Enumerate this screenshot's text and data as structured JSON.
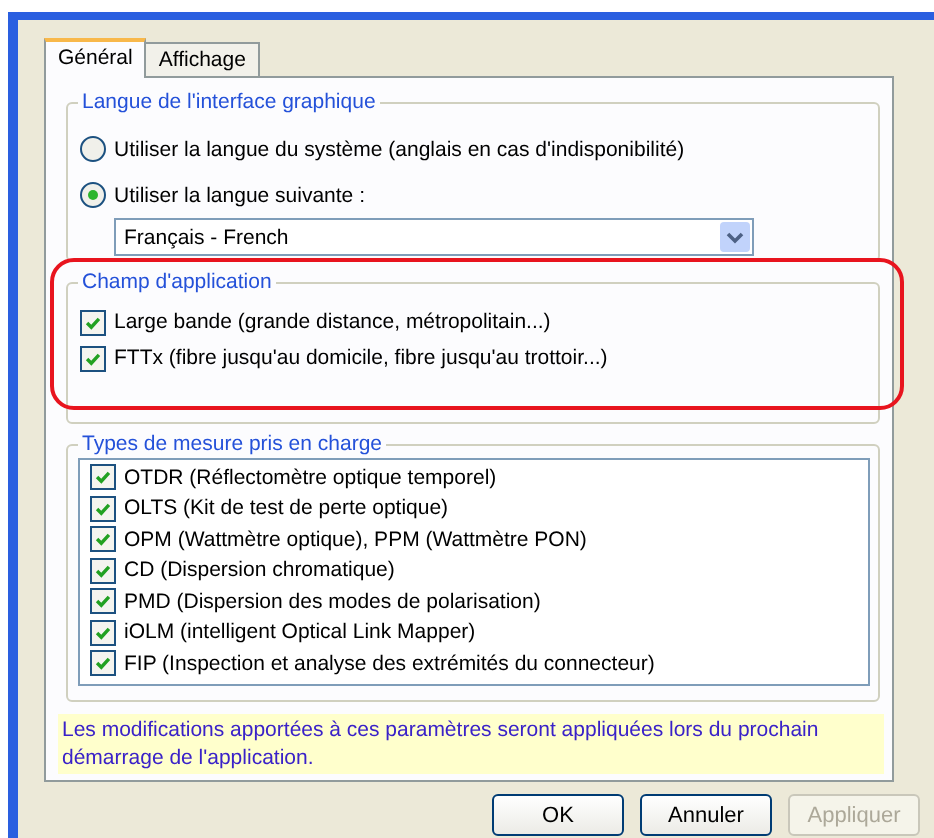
{
  "tabs": [
    {
      "label": "Général",
      "selected": true
    },
    {
      "label": "Affichage",
      "selected": false
    }
  ],
  "language_group": {
    "title": "Langue de l'interface graphique",
    "options": [
      {
        "label": "Utiliser la langue du système (anglais en cas d'indisponibilité)",
        "selected": false
      },
      {
        "label": "Utiliser la langue suivante :",
        "selected": true
      }
    ],
    "dropdown": {
      "value": "Français - French"
    }
  },
  "scope_group": {
    "title": "Champ d'application",
    "highlighted": true,
    "items": [
      {
        "label": "Large bande (grande distance, métropolitain...)",
        "checked": true
      },
      {
        "label": "FTTx (fibre jusqu'au domicile, fibre jusqu'au trottoir...)",
        "checked": true
      }
    ]
  },
  "measurement_group": {
    "title": "Types de mesure pris en charge",
    "items": [
      {
        "label": "OTDR (Réflectomètre optique temporel)",
        "checked": true
      },
      {
        "label": "OLTS (Kit de test de perte optique)",
        "checked": true
      },
      {
        "label": "OPM (Wattmètre optique), PPM (Wattmètre PON)",
        "checked": true
      },
      {
        "label": "CD (Dispersion chromatique)",
        "checked": true
      },
      {
        "label": "PMD (Dispersion des modes de polarisation)",
        "checked": true
      },
      {
        "label": "iOLM (intelligent Optical Link Mapper)",
        "checked": true
      },
      {
        "label": "FIP (Inspection et analyse des extrémités du connecteur)",
        "checked": true
      }
    ]
  },
  "note": "Les modifications apportées à ces paramètres seront appliquées lors du prochain démarrage de l'application.",
  "buttons": [
    {
      "label": "OK",
      "disabled": false
    },
    {
      "label": "Annuler",
      "disabled": false
    },
    {
      "label": "Appliquer",
      "disabled": true
    }
  ]
}
